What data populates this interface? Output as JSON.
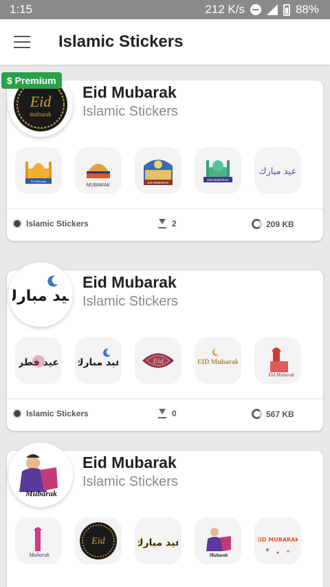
{
  "status_bar": {
    "time": "1:15",
    "speed": "212 K/s",
    "battery": "88%"
  },
  "app_bar": {
    "title": "Islamic Stickers",
    "menu_icon": "hamburger-menu-icon"
  },
  "packs": [
    {
      "name": "Eid Mubarak",
      "author": "Islamic Stickers",
      "premium_label": "$ Premium",
      "tray_text": "Eid",
      "tray_subtext": "mubarak",
      "sticker_texts": [
        "Eid Mubarak",
        "MUBARAK",
        "EID MUBARAK",
        "EID MUBARAK",
        "عيد مبارك"
      ],
      "footer_author": "Islamic Stickers",
      "downloads": "2",
      "size": "209 KB"
    },
    {
      "name": "Eid Mubarak",
      "author": "Islamic Stickers",
      "tray_text": "عيد مبارك",
      "sticker_texts": [
        "عيد فطر",
        "عيد مبارك",
        "Eid",
        "EID Mubarak",
        "Eid Mubarak"
      ],
      "footer_author": "Islamic Stickers",
      "downloads": "0",
      "size": "567 KB"
    },
    {
      "name": "Eid Mubarak",
      "author": "Islamic Stickers",
      "tray_text": "Mubarak",
      "sticker_texts": [
        "Mubarak",
        "Eid",
        "عيد مبارك",
        "Mubarak",
        "EID MUBARAK"
      ]
    }
  ],
  "colors": {
    "premium": "#2aa04a",
    "status_bar": "#8a8a8a",
    "gold": "#c8a040"
  }
}
